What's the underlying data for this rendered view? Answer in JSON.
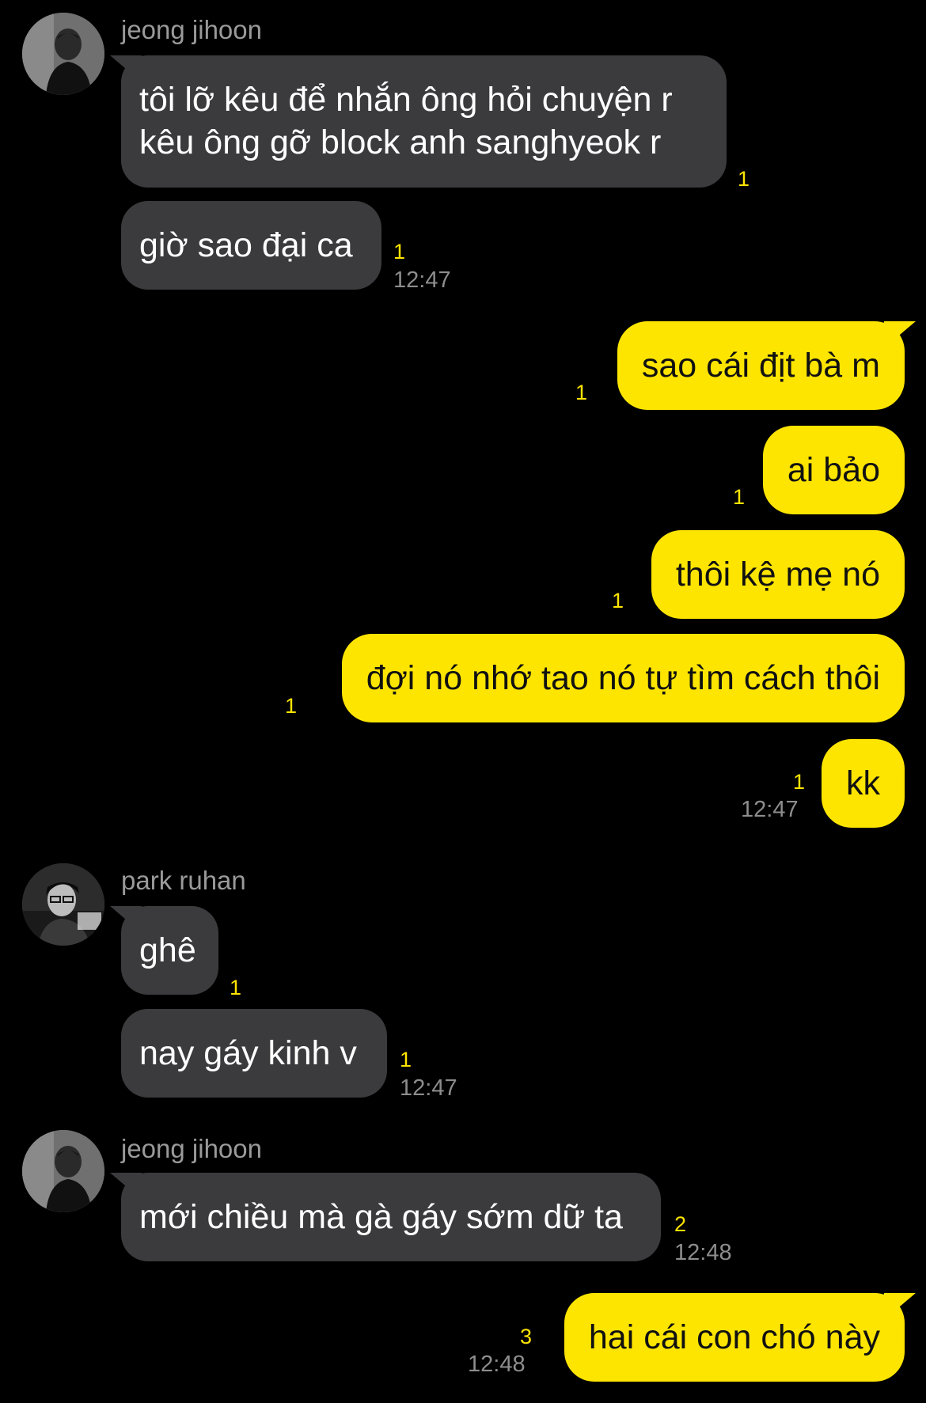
{
  "colors": {
    "background": "#000000",
    "incoming_bubble": "#3b3b3e",
    "outgoing_bubble": "#fee500",
    "unread_count": "#fee500",
    "timestamp": "#8d8d8d",
    "sender_name": "#9a9a9a"
  },
  "groups": [
    {
      "sender": "jeong jihoon",
      "avatar": "avatar-photo-jeong-jihoon",
      "messages": [
        {
          "lines": [
            "tôi lỡ kêu để nhắn ông hỏi chuyện r",
            "kêu ông gỡ block anh sanghyeok r"
          ],
          "unread": "1",
          "time": ""
        },
        {
          "lines": [
            "giờ sao đại ca"
          ],
          "unread": "1",
          "time": "12:47"
        }
      ]
    },
    {
      "sender": "me",
      "messages": [
        {
          "text": "sao cái địt bà m",
          "unread": "1",
          "time": ""
        },
        {
          "text": "ai bảo",
          "unread": "1",
          "time": ""
        },
        {
          "text": "thôi kệ mẹ nó",
          "unread": "1",
          "time": ""
        },
        {
          "text": "đợi nó nhớ tao nó tự tìm cách thôi",
          "unread": "1",
          "time": ""
        },
        {
          "text": "kk",
          "unread": "1",
          "time": "12:47"
        }
      ]
    },
    {
      "sender": "park ruhan",
      "avatar": "avatar-photo-park-ruhan",
      "messages": [
        {
          "lines": [
            "ghê"
          ],
          "unread": "1",
          "time": ""
        },
        {
          "lines": [
            "nay gáy kinh v"
          ],
          "unread": "1",
          "time": "12:47"
        }
      ]
    },
    {
      "sender": "jeong jihoon",
      "avatar": "avatar-photo-jeong-jihoon",
      "messages": [
        {
          "lines": [
            "mới chiều mà gà gáy sớm dữ ta"
          ],
          "unread": "2",
          "time": "12:48"
        }
      ]
    },
    {
      "sender": "me",
      "messages": [
        {
          "text": "hai cái con chó này",
          "unread": "3",
          "time": "12:48"
        }
      ]
    }
  ]
}
